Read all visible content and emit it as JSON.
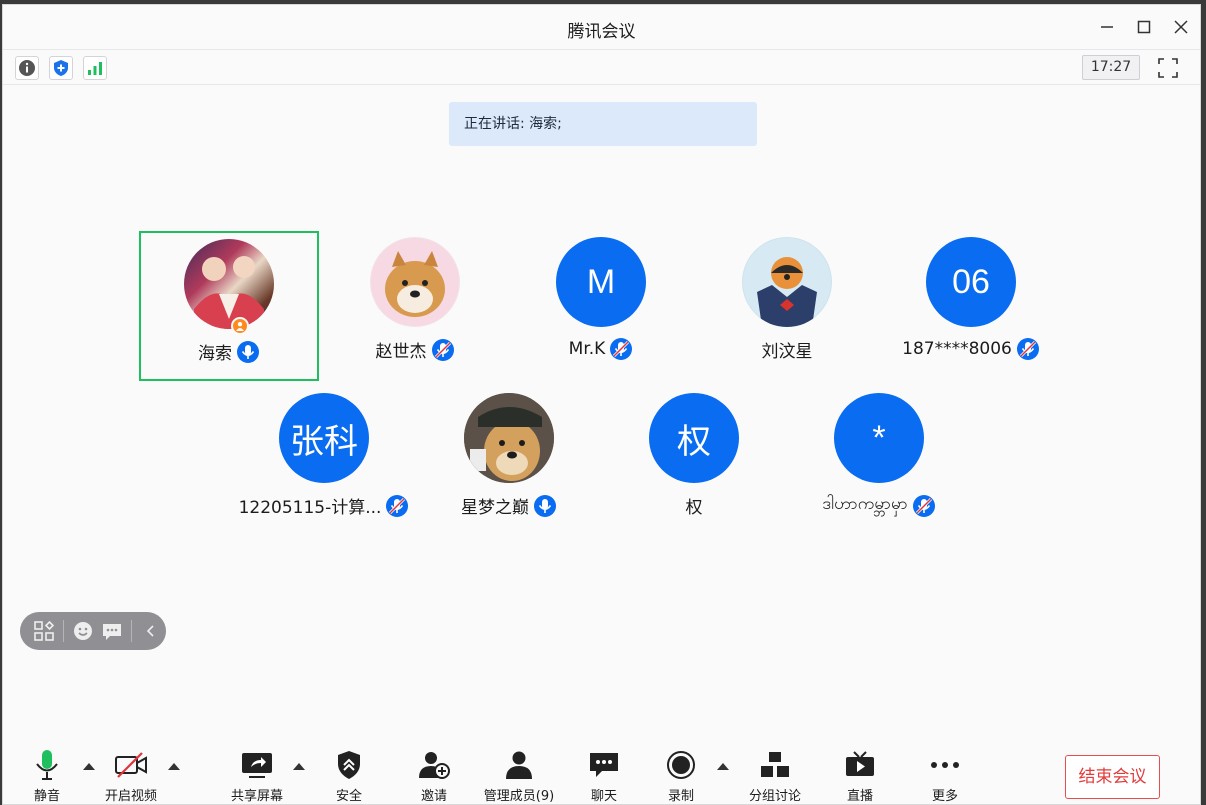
{
  "window": {
    "title": "腾讯会议",
    "clock": "17:27"
  },
  "speaking": {
    "text": "正在讲话: 海索;"
  },
  "participants": [
    {
      "name": "海索",
      "avatar_text": "",
      "mic": "active",
      "host": true
    },
    {
      "name": "赵世杰",
      "avatar_text": "",
      "mic": "muted"
    },
    {
      "name": "Mr.K",
      "avatar_text": "M",
      "mic": "muted"
    },
    {
      "name": "刘汶星",
      "avatar_text": "",
      "mic": "none"
    },
    {
      "name": "187****8006",
      "avatar_text": "06",
      "mic": "muted"
    },
    {
      "name": "12205115-计算...",
      "avatar_text": "张科",
      "mic": "muted"
    },
    {
      "name": "星梦之巅",
      "avatar_text": "",
      "mic": "active"
    },
    {
      "name": "权",
      "avatar_text": "权",
      "mic": "none"
    },
    {
      "name": "ဒါဟာကမ္ဘာမှာ",
      "avatar_text": "*",
      "mic": "muted"
    }
  ],
  "toolbar": {
    "mute": "静音",
    "video": "开启视频",
    "share": "共享屏幕",
    "security": "安全",
    "invite": "邀请",
    "members": "管理成员(9)",
    "chat": "聊天",
    "record": "录制",
    "breakout": "分组讨论",
    "live": "直播",
    "more": "更多",
    "end": "结束会议"
  },
  "icons": {
    "info": "info-icon",
    "shield": "shield-icon",
    "signal": "signal-icon"
  },
  "colors": {
    "accent": "#0a6cf0",
    "active_border": "#1fbf60",
    "end": "#e23b3b"
  }
}
